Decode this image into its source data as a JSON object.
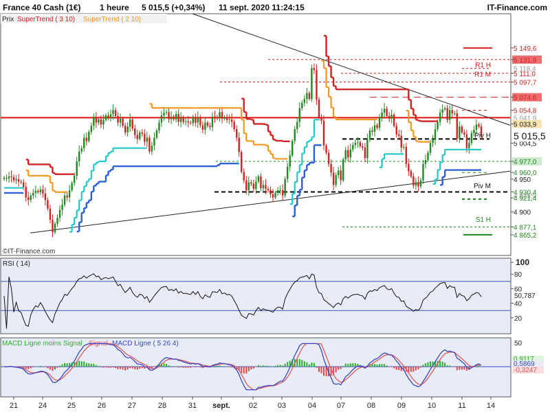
{
  "header": {
    "instrument": "France 40 Cash (1€)",
    "period": "1 heure",
    "price_change": "5 015,5 (+0,34%)",
    "datetime": "11 sept. 2020 11:24:15",
    "site": "IT-Finance.com"
  },
  "legend": {
    "prix": "Prix",
    "st1": "SuperTrend ( 3 10)",
    "st2": "SuperTrend ( 2 10)"
  },
  "watermark": "©IT-Finance.com",
  "colors": {
    "up": "#1f8a1f",
    "down": "#d42020",
    "st1_up": "#2a5fd8",
    "st1_down": "#d42020",
    "st2_up": "#20c8c8",
    "st2_down": "#f5961e",
    "rsi": "#111111",
    "macd": "#3848c8",
    "signal": "#e05a5a",
    "hist_pos": "#2bb02b",
    "hist_neg": "#e24a4a",
    "bg_main": "#ffffff",
    "bg_rsi": "#e8ecf8",
    "bg_macd": "#e8ecf8"
  },
  "chart_data": [
    {
      "type": "candlestick",
      "name": "price",
      "ylim": [
        4840,
        5185
      ],
      "y_ticks": [
        {
          "value": 5149.6,
          "label": "5 149,6"
        },
        {
          "value": 5131.9,
          "label": "5 131,9",
          "box": "#ec6f6f"
        },
        {
          "value": 5111.0,
          "label": "5 111,0"
        },
        {
          "value": 5097.7,
          "label": "5 097,7"
        },
        {
          "value": 5074.6,
          "label": "5 074,6",
          "box": "#ec6f6f"
        },
        {
          "value": 5054.8,
          "label": "5 054,8"
        },
        {
          "value": 5033.9,
          "label": "5 033,9",
          "box": "#fbe2b2"
        },
        {
          "value": 5004.5,
          "label": "5 004,5"
        },
        {
          "value": 4977.0,
          "label": "4 977,0",
          "box": "#cfeacf"
        },
        {
          "value": 4960.0,
          "label": "4 960,0"
        },
        {
          "value": 4950.0,
          "label": "4 950"
        },
        {
          "value": 4930.4,
          "label": "4 930,4"
        },
        {
          "value": 4921.4,
          "label": "4 921,4"
        },
        {
          "value": 4900.0,
          "label": "4 900"
        },
        {
          "value": 4877.1,
          "label": "4 877,1"
        },
        {
          "value": 4865.2,
          "label": "4 865,2"
        }
      ],
      "partial_ticks": [
        {
          "value": 5118.5,
          "label": "5 118,4"
        },
        {
          "value": 5043.5,
          "label": "5 041,9"
        },
        {
          "value": 4925.0,
          "label": "4 925,0"
        }
      ],
      "last_price": {
        "value": 5015.5,
        "label": "5 015,5"
      },
      "pivot_labels": [
        {
          "text": "R1 H",
          "value": 5118
        },
        {
          "text": "R1 M",
          "value": 5104
        },
        {
          "text": "Piv H",
          "value": 5011
        },
        {
          "text": "Piv M",
          "value": 4934
        },
        {
          "text": "S1 H",
          "value": 4883
        }
      ],
      "x_labels": [
        "21",
        "24",
        "25",
        "26",
        "27",
        "28",
        "31",
        "sept.",
        "02",
        "03",
        "04",
        "07",
        "08",
        "09",
        "10",
        "11",
        "14"
      ],
      "candles_close": [
        4952,
        4951,
        4954,
        4953,
        4948,
        4950,
        4946,
        4945,
        4938,
        4922,
        4918,
        4925,
        4929,
        4932,
        4930,
        4934,
        4928,
        4918,
        4905,
        4888,
        4869,
        4882,
        4891,
        4903,
        4911,
        4925,
        4922,
        4933,
        4944,
        4955,
        4977,
        4992,
        4997,
        5013,
        5008,
        5022,
        5031,
        5043,
        5036,
        5041,
        5033,
        5040,
        5047,
        5044,
        5049,
        5055,
        5046,
        5036,
        5042,
        5031,
        5021,
        5030,
        5041,
        5027,
        5017,
        5011,
        5021,
        5019,
        5007,
        5013,
        4992,
        5001,
        5013,
        5024,
        5036,
        5047,
        5051,
        5052,
        5041,
        5045,
        5041,
        5049,
        5037,
        5043,
        5037,
        5038,
        5036,
        5035,
        5043,
        5036,
        5044,
        5032,
        5025,
        5036,
        5031,
        5029,
        5045,
        5044,
        5043,
        5052,
        5042,
        5044,
        5040,
        5041,
        5037,
        5026,
        5013,
        4991,
        4961,
        4948,
        4933,
        4945,
        4943,
        4935,
        4946,
        4954,
        4936,
        4941,
        4935,
        4933,
        4927,
        4922,
        4929,
        4933,
        4933,
        4925,
        4950,
        4969,
        4986,
        5008,
        5026,
        5037,
        5058,
        5066,
        5072,
        5081,
        5072,
        5119,
        5116,
        5071,
        5043,
        5039,
        5001,
        4990,
        4973,
        4960,
        4941,
        4956,
        4963,
        4948,
        4980,
        4994,
        4983,
        4995,
        5002,
        5005,
        5006,
        5000,
        4998,
        4982,
        5010,
        5024,
        5022,
        5032,
        5028,
        5044,
        5051,
        5057,
        5046,
        5042,
        5048,
        5031,
        5018,
        5016,
        4998,
        4999,
        4973,
        4962,
        4954,
        4940,
        4945,
        4939,
        4948,
        4973,
        4979,
        4990,
        5005,
        5010,
        5026,
        5037,
        5051,
        5056,
        5058,
        5040,
        5055,
        5050,
        5050,
        5012,
        5030,
        5021,
        5018,
        4997,
        5005,
        5020,
        5025,
        5033,
        5030,
        5015.5
      ]
    },
    {
      "type": "line",
      "name": "RSI ( 14)",
      "ylim": [
        0,
        100
      ],
      "y_ticks": [
        {
          "value": 100,
          "label": "100"
        },
        {
          "value": 80,
          "label": "80"
        },
        {
          "value": 60,
          "label": "60"
        },
        {
          "value": 40,
          "label": "40"
        },
        {
          "value": 20,
          "label": "20"
        }
      ],
      "bands": [
        70,
        30
      ],
      "last_value": {
        "value": 50.787,
        "label": "50,787"
      }
    },
    {
      "type": "line",
      "name": "MACD",
      "legend": [
        "MACD Ligne moins Signal",
        "Signal",
        "MACD Ligne ( 5 26 4)"
      ],
      "ylim": [
        -50,
        50
      ],
      "y_ticks": [
        {
          "value": 50,
          "label": "50"
        }
      ],
      "last_values": [
        {
          "value": 0.9117,
          "label": "0,9117"
        },
        {
          "value": 0.5869,
          "label": "0,5869"
        },
        {
          "value": -0.3247,
          "label": "-0,3247"
        }
      ]
    }
  ]
}
